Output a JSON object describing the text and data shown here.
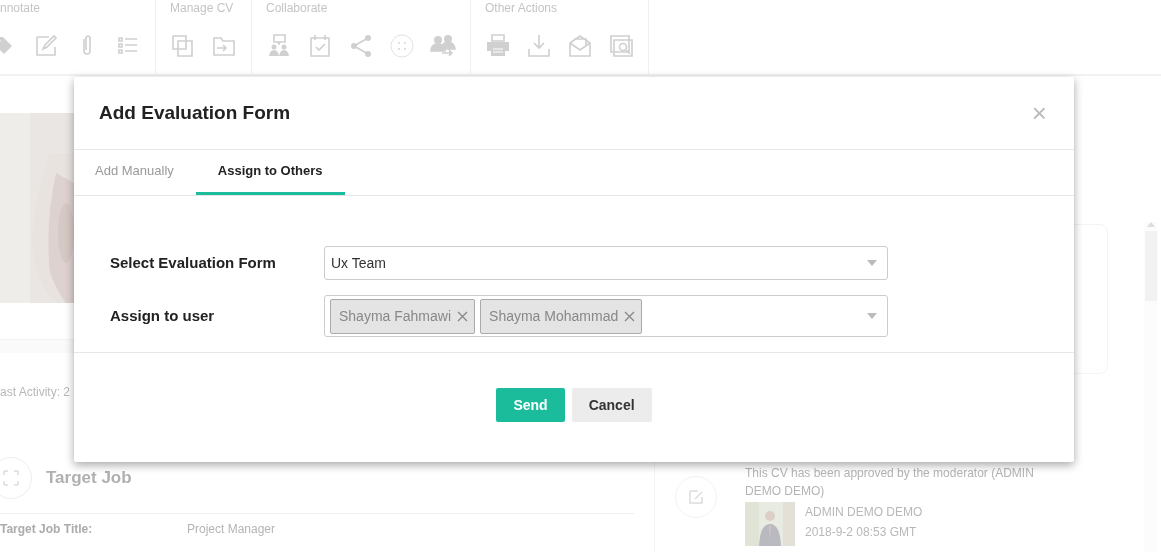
{
  "toolbar": {
    "groups": [
      {
        "title": "nnotate"
      },
      {
        "title": "Manage CV"
      },
      {
        "title": "Collaborate"
      },
      {
        "title": "Other Actions"
      }
    ]
  },
  "profile": {
    "last_activity": "ast Activity: 2"
  },
  "target_job": {
    "heading": "Target Job",
    "fields": [
      {
        "label": "Target Job Title:",
        "value": "Project Manager"
      }
    ]
  },
  "timeline": {
    "entries": [
      {
        "text": "This CV has been approved by the moderator (ADMIN DEMO DEMO)",
        "author": "ADMIN DEMO DEMO",
        "time": "2018-9-2 08:53 GMT"
      }
    ]
  },
  "modal": {
    "title": "Add Evaluation Form",
    "close": "×",
    "tabs": [
      {
        "label": "Add Manually",
        "selected": false
      },
      {
        "label": "Assign to Others",
        "selected": true
      }
    ],
    "fields": [
      {
        "kind": "select",
        "label": "Select Evaluation Form",
        "value": "Ux Team"
      },
      {
        "kind": "tags",
        "label": "Assign to user",
        "tags": [
          "Shayma Fahmawi",
          "Shayma Mohammad"
        ]
      }
    ],
    "buttons": [
      {
        "label": "Send",
        "kind": "primary"
      },
      {
        "label": "Cancel",
        "kind": "secondary"
      }
    ]
  }
}
